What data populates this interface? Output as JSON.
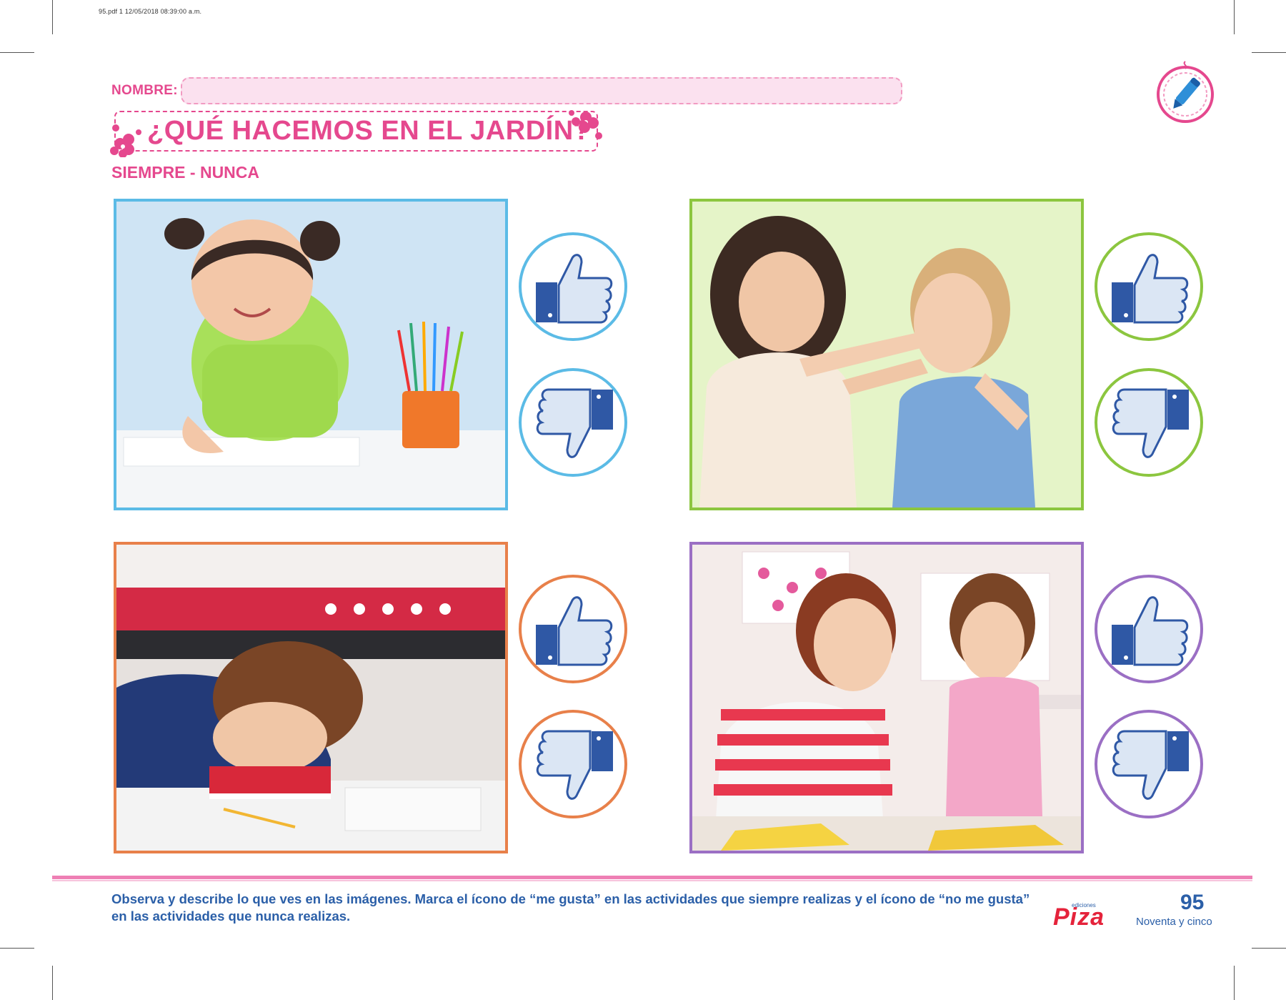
{
  "print_header": "95.pdf   1   12/05/2018   08:39:00 a.m.",
  "worksheet": {
    "name_label": "NOMBRE:",
    "title": "¿QUÉ HACEMOS EN EL JARDÍN?",
    "subtitle": "SIEMPRE - NUNCA"
  },
  "colors": {
    "pink": "#e5488e",
    "blue": "#5bbbe6",
    "green": "#8cc63f",
    "orange": "#e8804a",
    "purple": "#9b6fc4",
    "text_blue": "#2b5fa8"
  },
  "activities": [
    {
      "photo": "girl-drawing-photo",
      "frame_color": "#5bbbe6",
      "like_icon": "thumbs-up-icon",
      "dislike_icon": "thumbs-down-icon"
    },
    {
      "photo": "girls-fighting-photo",
      "frame_color": "#8cc63f",
      "like_icon": "thumbs-up-icon",
      "dislike_icon": "thumbs-down-icon"
    },
    {
      "photo": "boy-sleeping-photo",
      "frame_color": "#e8804a",
      "like_icon": "thumbs-up-icon",
      "dislike_icon": "thumbs-down-icon"
    },
    {
      "photo": "teacher-crafting-photo",
      "frame_color": "#9b6fc4",
      "like_icon": "thumbs-up-icon",
      "dislike_icon": "thumbs-down-icon"
    }
  ],
  "footer": {
    "instructions": "Observa y describe lo que ves en las imágenes. Marca el ícono de “me gusta” en las actividades que siempre realizas y el ícono de “no me gusta” en las actividades que nunca realizas.",
    "publisher_small": "ediciones",
    "publisher": "Piza",
    "page_number": "95",
    "page_words": "Noventa y cinco"
  }
}
